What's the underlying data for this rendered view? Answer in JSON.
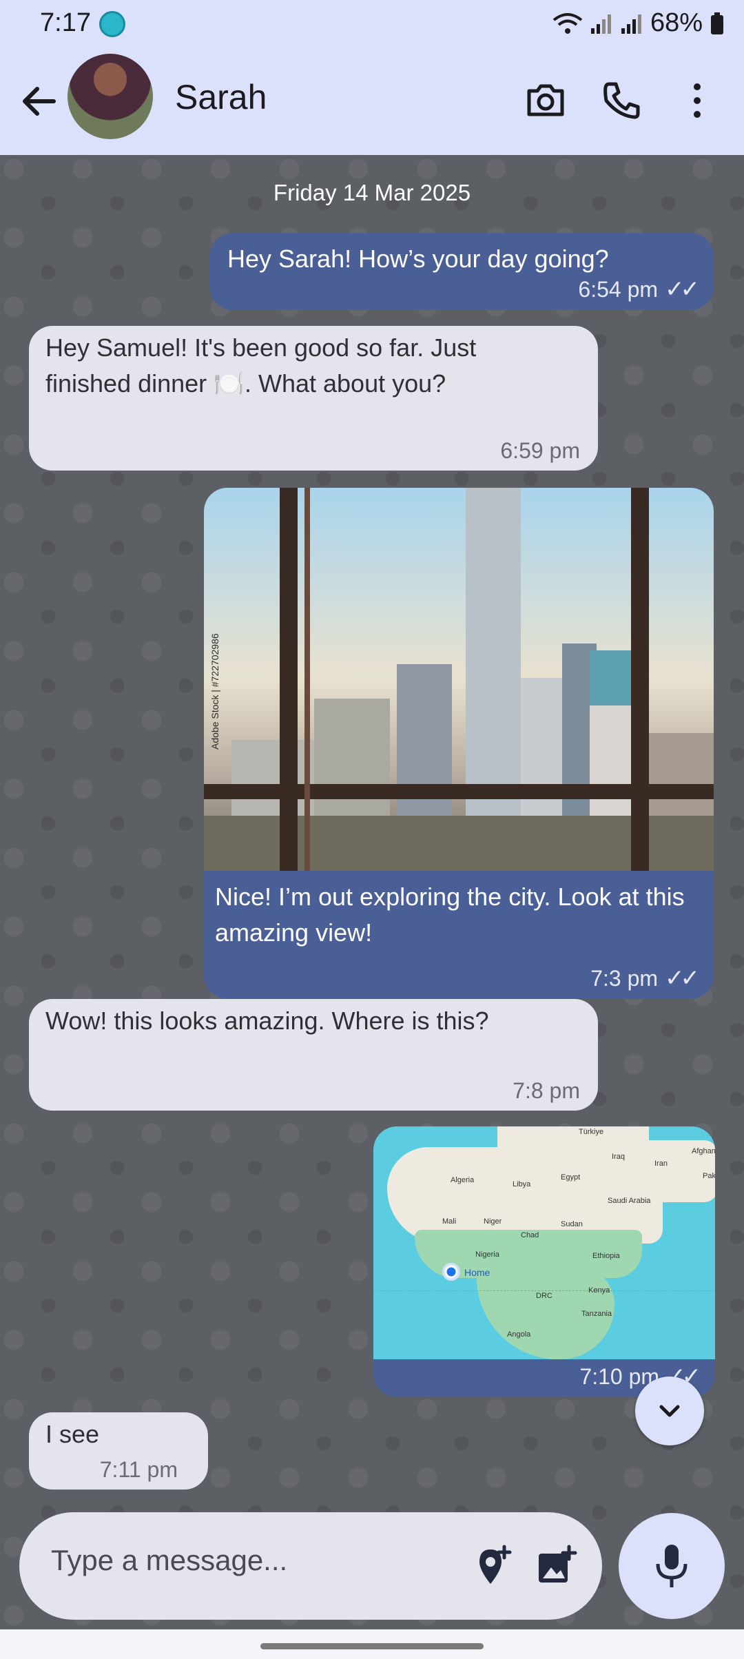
{
  "status_bar": {
    "time": "7:17",
    "battery": "68%"
  },
  "header": {
    "contact_name": "Sarah",
    "icons": [
      "back-arrow-icon",
      "camera-icon",
      "phone-icon",
      "more-vert-icon"
    ]
  },
  "chat": {
    "date_label": "Friday 14 Mar 2025",
    "messages": [
      {
        "direction": "outgoing",
        "text": "Hey Sarah! How’s your day going?",
        "time": "6:54 pm",
        "ticks": "✓✓"
      },
      {
        "direction": "incoming",
        "text": "Hey Samuel! It's been good so far. Just finished dinner 🍽️. What about you?",
        "time": "6:59 pm"
      },
      {
        "direction": "outgoing",
        "type": "image",
        "image_watermark": "Adobe Stock | #722702986",
        "text": "Nice! I’m out exploring the city. Look at this amazing view!",
        "time": "7:3 pm",
        "ticks": "✓✓"
      },
      {
        "direction": "incoming",
        "text": "Wow! this looks amazing. Where is this?",
        "time": "7:8 pm"
      },
      {
        "direction": "outgoing",
        "type": "location",
        "map_labels": [
          "Türkiye",
          "Iraq",
          "Iran",
          "Afghan",
          "Pak",
          "Algeria",
          "Libya",
          "Egypt",
          "Saudi Arabia",
          "Mali",
          "Niger",
          "Sudan",
          "Chad",
          "Nigeria",
          "Ethiopia",
          "Home",
          "DRC",
          "Kenya",
          "Tanzania",
          "Angola"
        ],
        "time": "7:10 pm",
        "ticks": "✓✓"
      },
      {
        "direction": "incoming",
        "text": "I see",
        "time": "7:11 pm"
      }
    ]
  },
  "composer": {
    "placeholder": "Type a message..."
  },
  "colors": {
    "header_bg": "#dbe1fb",
    "outgoing_bubble": "#4a5f96",
    "incoming_bubble": "#e4e4ec"
  }
}
